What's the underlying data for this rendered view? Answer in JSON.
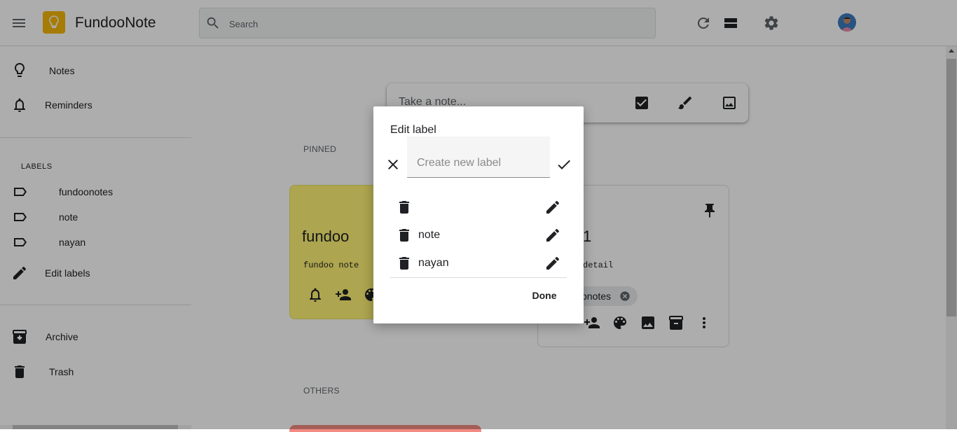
{
  "header": {
    "app_title": "FundooNote",
    "search_placeholder": "Search",
    "icons": [
      "menu-icon",
      "keep-bulb-logo",
      "search-icon",
      "refresh-icon",
      "view-toggle-icon",
      "settings-icon",
      "avatar"
    ]
  },
  "sidebar": {
    "items": [
      {
        "label": "Notes",
        "icon": "lightbulb-icon"
      },
      {
        "label": "Reminders",
        "icon": "bell-icon"
      }
    ],
    "labels_title": "LABELS",
    "labels": [
      "fundoonotes",
      "note",
      "nayan"
    ],
    "edit_labels": "Edit labels",
    "bottom_items": [
      {
        "label": "Archive",
        "icon": "archive-icon"
      },
      {
        "label": "Trash",
        "icon": "trash-icon"
      }
    ]
  },
  "main": {
    "take_note_placeholder": "Take a note...",
    "pinned_label": "PINNED",
    "others_label": "OTHERS",
    "cards": [
      {
        "title": "fundoo",
        "body": "fundoo note",
        "color": "#fff475"
      },
      {
        "title": "1",
        "body": "detail",
        "chip": "onotes",
        "color": "#ffffff"
      }
    ]
  },
  "dialog": {
    "title": "Edit label",
    "input_placeholder": "Create new label",
    "labels": [
      "",
      "note",
      "nayan"
    ],
    "done_label": "Done"
  },
  "colors": {
    "logo": "#f5b50a",
    "yellow_card": "#fff475",
    "overlay": "rgba(0,0,0,0.32)"
  }
}
